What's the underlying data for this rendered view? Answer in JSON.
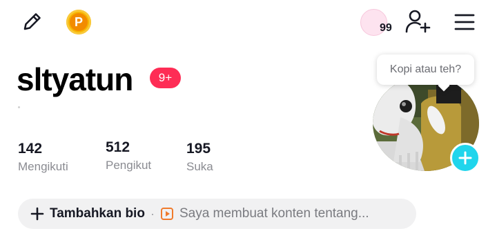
{
  "top_bar": {
    "notification_count": "99"
  },
  "profile": {
    "username": "sltyatun",
    "badge": "9+"
  },
  "stats": [
    {
      "value": "142",
      "label": "Mengikuti"
    },
    {
      "value": "512",
      "label": "Pengikut"
    },
    {
      "value": "195",
      "label": "Suka"
    }
  ],
  "avatar": {
    "tooltip": "Kopi atau teh?"
  },
  "bio": {
    "add_label": "Tambahkan bio",
    "separator": "·",
    "hint": "Saya membuat konten tentang..."
  },
  "colors": {
    "badge": "#fe2c55",
    "add_avatar": "#20d5ec",
    "coin": "#f7b500",
    "bio_icon": "#f07a2b"
  }
}
